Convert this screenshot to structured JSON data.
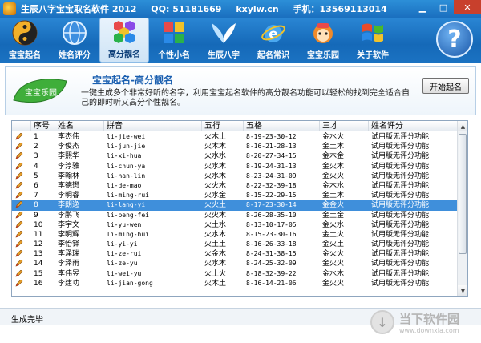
{
  "titlebar": {
    "app_name": "生辰八字宝宝取名软件 2012",
    "qq": "QQ: 51181669",
    "site": "kxylw.cn",
    "phone": "手机：13569113014",
    "buttons": [
      "▁",
      "□",
      "✕"
    ]
  },
  "toolbar": {
    "items": [
      {
        "label": "宝宝起名",
        "icon": "yin-yang-icon"
      },
      {
        "label": "姓名评分",
        "icon": "globe-icon"
      },
      {
        "label": "高分靓名",
        "icon": "hexagon-cluster-icon",
        "active": true
      },
      {
        "label": "个性小名",
        "icon": "puzzle-icon"
      },
      {
        "label": "生辰八字",
        "icon": "wings-icon"
      },
      {
        "label": "起名常识",
        "icon": "ie-icon"
      },
      {
        "label": "宝宝乐园",
        "icon": "mascot-icon"
      },
      {
        "label": "关于软件",
        "icon": "windows-logo-icon"
      }
    ],
    "help": "?"
  },
  "header": {
    "badge": "宝宝乐园",
    "title": "宝宝起名-高分靓名",
    "description": "一键生成多个非常好听的名字，利用宝宝起名软件的高分靓名功能可以轻松的找到完全适合自己的即时听又高分个性靓名。",
    "start_button": "开始起名"
  },
  "table": {
    "columns": [
      "序号",
      "姓名",
      "拼音",
      "五行",
      "五格",
      "三才",
      "姓名评分"
    ],
    "selected_index": 7,
    "rows": [
      [
        "1",
        "李杰伟",
        "li-jie-wei",
        "火木土",
        "8-19-23-30-12",
        "金水火",
        "试用版无评分功能"
      ],
      [
        "2",
        "李俊杰",
        "li-jun-jie",
        "火木木",
        "8-16-21-28-13",
        "金土木",
        "试用版无评分功能"
      ],
      [
        "3",
        "李熙华",
        "li-xi-hua",
        "火水水",
        "8-20-27-34-15",
        "金木金",
        "试用版无评分功能"
      ],
      [
        "4",
        "李淳雅",
        "li-chun-ya",
        "火水木",
        "8-19-24-31-13",
        "金火木",
        "试用版无评分功能"
      ],
      [
        "5",
        "李翰林",
        "li-han-lin",
        "火水木",
        "8-23-24-31-09",
        "金火火",
        "试用版无评分功能"
      ],
      [
        "6",
        "李德懋",
        "li-de-mao",
        "火火木",
        "8-22-32-39-18",
        "金木水",
        "试用版无评分功能"
      ],
      [
        "7",
        "李明睿",
        "li-ming-rui",
        "火水金",
        "8-15-22-29-15",
        "金土木",
        "试用版无评分功能"
      ],
      [
        "8",
        "李朗逸",
        "li-lang-yi",
        "火火土",
        "8-17-23-30-14",
        "金金火",
        "试用版无评分功能"
      ],
      [
        "9",
        "李鹏飞",
        "li-peng-fei",
        "火火木",
        "8-26-28-35-10",
        "金土金",
        "试用版无评分功能"
      ],
      [
        "10",
        "李宇文",
        "li-yu-wen",
        "火土水",
        "8-13-10-17-05",
        "金火水",
        "试用版无评分功能"
      ],
      [
        "11",
        "李明辉",
        "li-ming-hui",
        "火水木",
        "8-15-23-30-16",
        "金土火",
        "试用版无评分功能"
      ],
      [
        "12",
        "李怡铎",
        "li-yi-yi",
        "火土土",
        "8-16-26-33-18",
        "金火土",
        "试用版无评分功能"
      ],
      [
        "13",
        "李泽瑞",
        "li-ze-rui",
        "火金木",
        "8-24-31-38-15",
        "金火火",
        "试用版无评分功能"
      ],
      [
        "14",
        "李泽雨",
        "li-ze-yu",
        "火水木",
        "8-24-25-32-09",
        "金火火",
        "试用版无评分功能"
      ],
      [
        "15",
        "李伟昱",
        "li-wei-yu",
        "火土火",
        "8-18-32-39-22",
        "金水木",
        "试用版无评分功能"
      ],
      [
        "16",
        "李建功",
        "li-jian-gong",
        "火木土",
        "8-16-14-21-06",
        "金火火",
        "试用版无评分功能"
      ]
    ]
  },
  "status": {
    "text": "生成完毕"
  },
  "watermark": {
    "main": "当下软件园",
    "sub": "www.downxia.com"
  }
}
